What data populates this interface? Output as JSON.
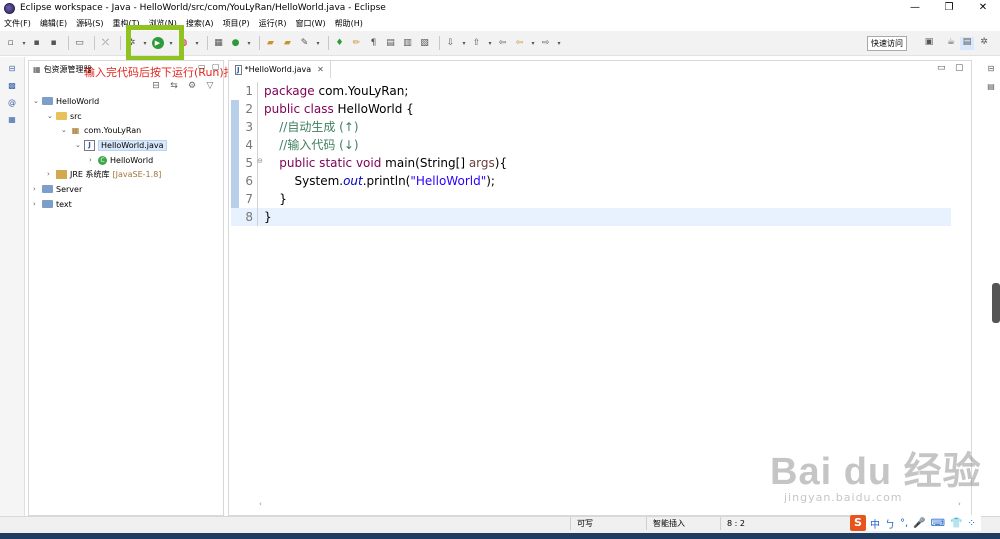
{
  "window": {
    "title": "Eclipse workspace - Java - HelloWorld/src/com/YouLyRan/HelloWorld.java - Eclipse",
    "minimize": "—",
    "restore": "❐",
    "close": "✕"
  },
  "menu": [
    "文件(F)",
    "编辑(E)",
    "源码(S)",
    "重构(T)",
    "浏览(N)",
    "搜索(A)",
    "项目(P)",
    "运行(R)",
    "窗口(W)",
    "帮助(H)"
  ],
  "toolbar": {
    "quick_access": "快速访问"
  },
  "annotation": "输入完代码后按下运行(Run)按钮",
  "explorer": {
    "title": "包资源管理器",
    "tree": [
      {
        "label": "HelloWorld",
        "arrow": "⌄",
        "icon": "proj"
      },
      {
        "label": "src",
        "arrow": "⌄",
        "icon": "folder"
      },
      {
        "label": "com.YouLyRan",
        "arrow": "⌄",
        "icon": "pkg"
      },
      {
        "label": "HelloWorld.java",
        "arrow": "⌄",
        "icon": "java"
      },
      {
        "label": "HelloWorld",
        "arrow": "›",
        "icon": "cls"
      },
      {
        "label": "JRE 系统库",
        "meta": "[JavaSE-1.8]",
        "arrow": "›",
        "icon": "lib"
      },
      {
        "label": "Server",
        "arrow": "›",
        "icon": "proj"
      },
      {
        "label": "text",
        "arrow": "›",
        "icon": "proj"
      }
    ]
  },
  "editor": {
    "tab_title": "*HelloWorld.java",
    "lines": [
      {
        "num": "1",
        "parts": [
          [
            "kw",
            "package"
          ],
          [
            "nm",
            " com.YouLyRan;"
          ]
        ]
      },
      {
        "num": "2",
        "parts": [
          [
            "kw",
            "public class"
          ],
          [
            "nm",
            " HelloWorld {"
          ]
        ]
      },
      {
        "num": "3",
        "parts": [
          [
            "nm",
            "    "
          ],
          [
            "cm",
            "//自动生成 (↑)"
          ]
        ]
      },
      {
        "num": "4",
        "parts": [
          [
            "nm",
            "    "
          ],
          [
            "cm",
            "//输入代码 (↓)"
          ]
        ]
      },
      {
        "num": "5",
        "parts": [
          [
            "nm",
            "    "
          ],
          [
            "kw",
            "public static void"
          ],
          [
            "nm",
            " main(String[] "
          ],
          [
            "pm",
            "args"
          ],
          [
            "nm",
            "){"
          ]
        ]
      },
      {
        "num": "6",
        "parts": [
          [
            "nm",
            "        System."
          ],
          [
            "it",
            "out"
          ],
          [
            "nm",
            ".println("
          ],
          [
            "st",
            "\"HelloWorld\""
          ],
          [
            "nm",
            ");"
          ]
        ]
      },
      {
        "num": "7",
        "parts": [
          [
            "nm",
            "    }"
          ]
        ]
      },
      {
        "num": "8",
        "parts": [
          [
            "nm",
            "}"
          ]
        ]
      }
    ]
  },
  "status": {
    "writable": "可写",
    "insert_mode": "智能插入",
    "position": "8 : 2"
  },
  "ime": {
    "logo": "S",
    "lang": "中",
    "items": [
      "ㄅ",
      "°,",
      "🎤",
      "⌨",
      "👕",
      "⁘"
    ]
  },
  "watermark": {
    "main": "Bai du 经验",
    "sub": "jingyan.baidu.com"
  }
}
